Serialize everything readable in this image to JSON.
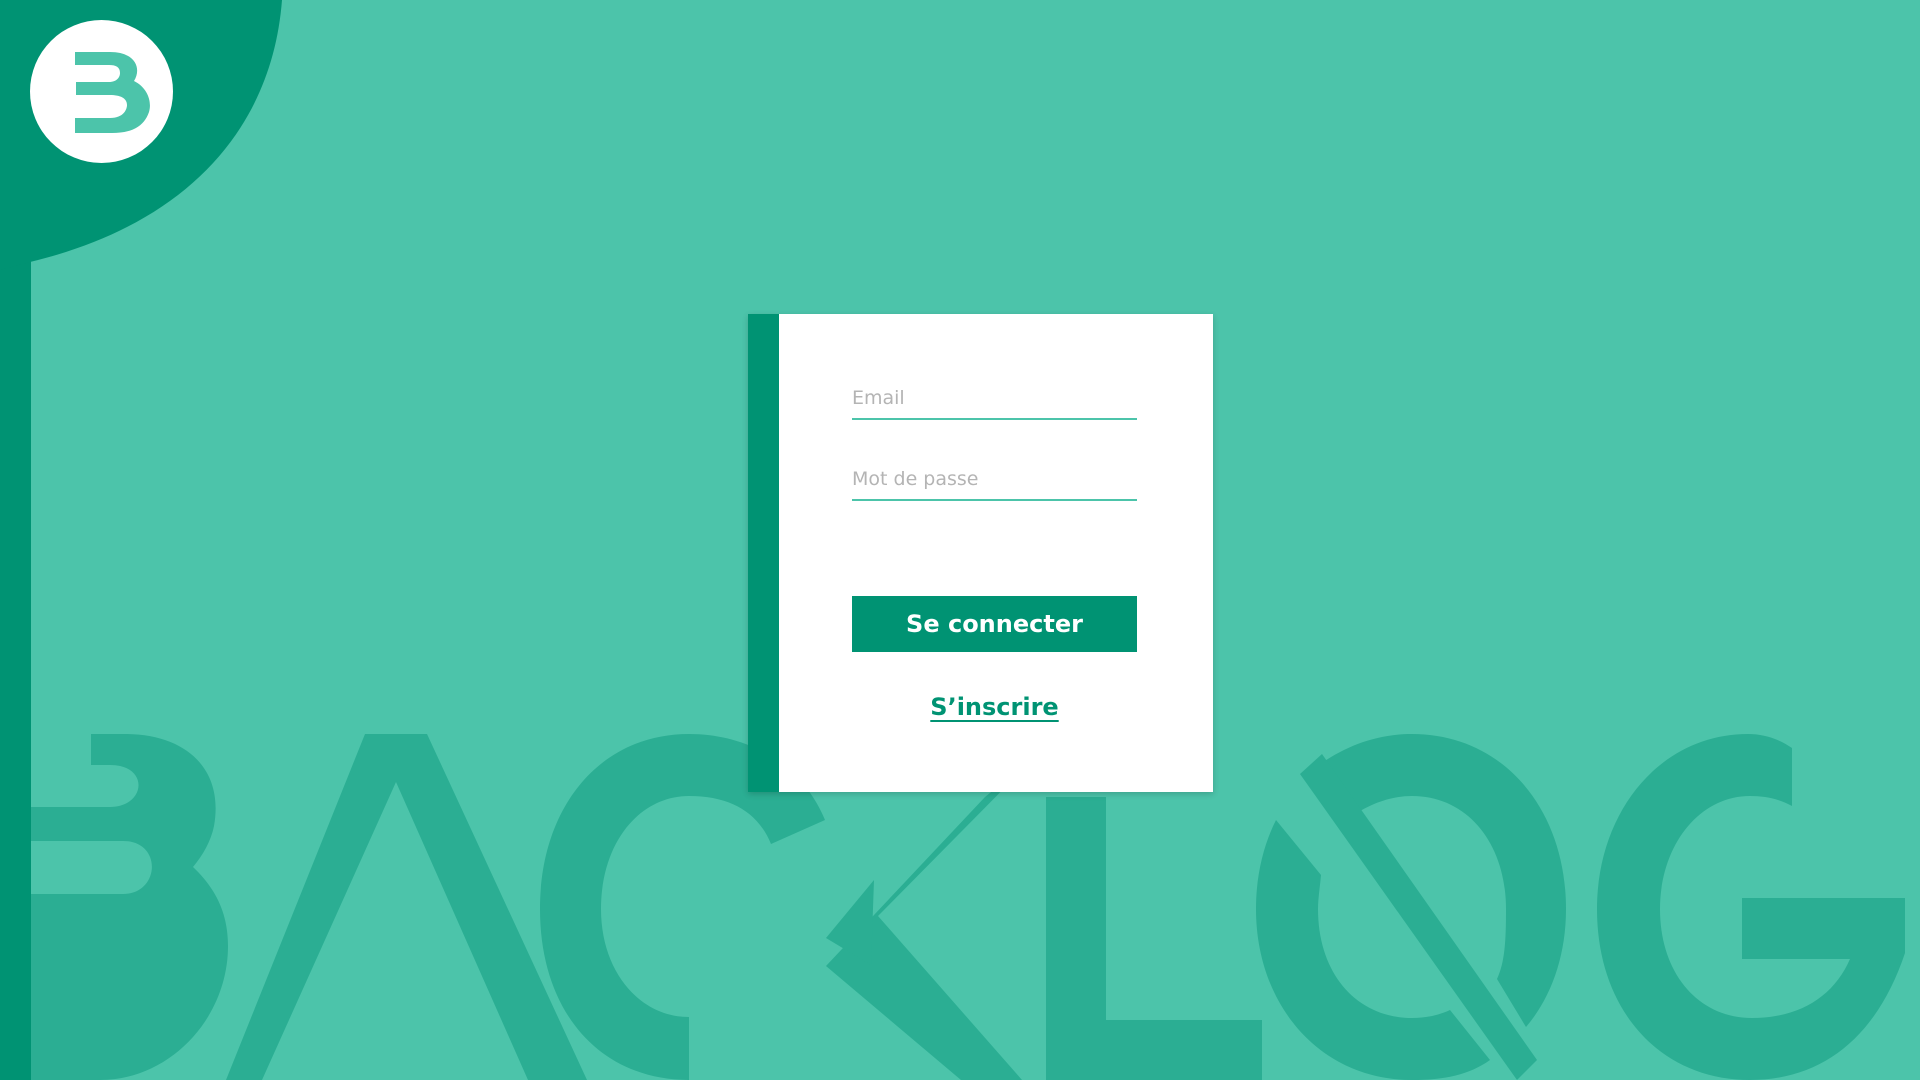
{
  "login": {
    "email_placeholder": "Email",
    "password_placeholder": "Mot de passe",
    "submit_label": "Se connecter",
    "signup_label": "S’inscrire"
  },
  "branding": {
    "logo_letter": "B",
    "background_wordmark": "BACKLOG",
    "logo_icon": "backlog-b-logo-icon"
  },
  "colors": {
    "background": "#4CC4AA",
    "primary": "#009373",
    "wordmark": "#2BAE93",
    "card": "#FFFFFF",
    "placeholder": "#B4B4B4"
  }
}
